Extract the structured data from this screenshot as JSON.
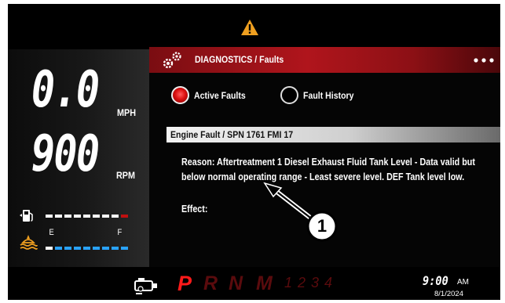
{
  "colors": {
    "accent_red": "#b0151c",
    "def_blue": "#29a3ff",
    "warning_amber": "#f0a020"
  },
  "icons": {
    "warning": "warning-triangle-icon",
    "diagnostics": "gears-icon",
    "fuel": "fuel-pump-icon",
    "def": "def-fluid-icon",
    "more": "more-dots-icon",
    "service": "service-icon"
  },
  "gauges": {
    "speed": {
      "value": "0.0",
      "unit": "MPH"
    },
    "rpm": {
      "value": "900",
      "unit": "RPM"
    },
    "def": {
      "empty_label": "E",
      "full_label": "F"
    }
  },
  "diagnostics": {
    "title": "DIAGNOSTICS / Faults",
    "tabs": [
      {
        "label": "Active Faults",
        "selected": true
      },
      {
        "label": "Fault History",
        "selected": false
      }
    ],
    "fault": {
      "title": "Engine Fault / SPN 1761 FMI 17",
      "reason": "Reason: Aftertreatment 1 Diesel Exhaust Fluid Tank Level - Data valid but below normal operating range - Least severe level.  DEF Tank level low.",
      "effect_label": "Effect:"
    }
  },
  "transmission": {
    "gears": [
      "P",
      "R",
      "N",
      "M"
    ],
    "manual_gears": "1234",
    "selected": "P"
  },
  "clock": {
    "time": "9:00",
    "ampm": "AM",
    "date": "8/1/2024"
  },
  "callout": {
    "label": "1"
  }
}
